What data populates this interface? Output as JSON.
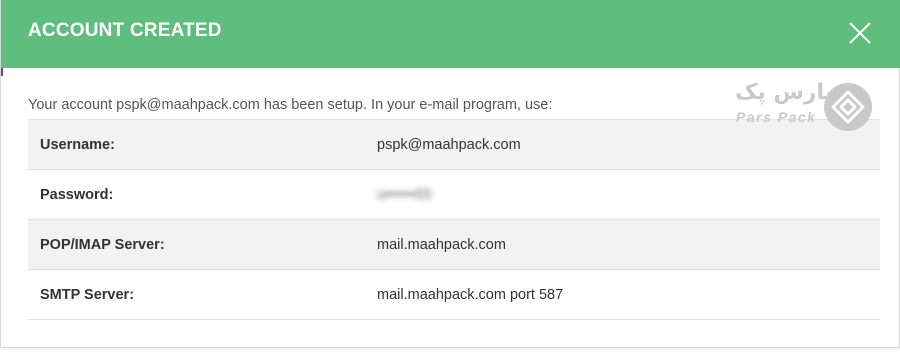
{
  "dialog": {
    "title": "ACCOUNT CREATED",
    "close_icon": "close-icon",
    "header_color": "#5fbe7e"
  },
  "intro_text": "Your account pspk@maahpack.com has been setup. In your e-mail program, use:",
  "details": [
    {
      "label": "Username:",
      "value": "pspk@maahpack.com"
    },
    {
      "label": "Password:",
      "value": "u••••••55"
    },
    {
      "label": "POP/IMAP Server:",
      "value": "mail.maahpack.com"
    },
    {
      "label": "SMTP Server:",
      "value": "mail.maahpack.com port 587"
    }
  ],
  "watermark": {
    "text_fa": "پارس پک",
    "text_en": "Pars Pack",
    "icon": "parspack-logo-icon"
  }
}
